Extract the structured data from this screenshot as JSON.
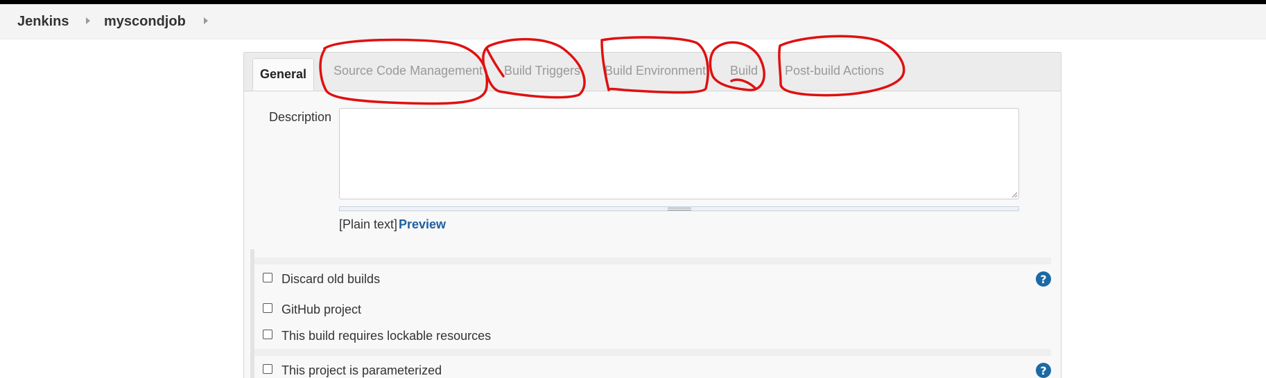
{
  "breadcrumb": {
    "items": [
      {
        "label": "Jenkins"
      },
      {
        "label": "myscondjob"
      }
    ]
  },
  "tabs": [
    {
      "label": "General",
      "active": true
    },
    {
      "label": "Source Code Management",
      "active": false
    },
    {
      "label": "Build Triggers",
      "active": false
    },
    {
      "label": "Build Environment",
      "active": false
    },
    {
      "label": "Build",
      "active": false
    },
    {
      "label": "Post-build Actions",
      "active": false
    }
  ],
  "description": {
    "label": "Description",
    "value": "",
    "format_label": "[Plain text]",
    "preview_link": "Preview"
  },
  "options": [
    {
      "label": "Discard old builds",
      "checked": false,
      "has_help": true
    },
    {
      "label": "GitHub project",
      "checked": false,
      "has_help": false
    },
    {
      "label": "This build requires lockable resources",
      "checked": false,
      "has_help": false
    },
    {
      "label": "This project is parameterized",
      "checked": false,
      "has_help": true
    }
  ],
  "help_icon_glyph": "?",
  "colors": {
    "accent_link": "#1e5e9e",
    "help_icon": "#1b6aa5",
    "annotation_red": "#e01010"
  }
}
